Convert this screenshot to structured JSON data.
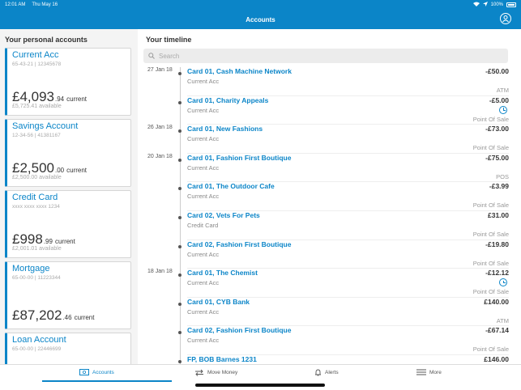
{
  "status": {
    "time": "12:01 AM",
    "date": "Thu May 16",
    "battery": "100%"
  },
  "nav": {
    "title": "Accounts"
  },
  "left": {
    "heading": "Your personal accounts",
    "accounts": [
      {
        "name": "Current Acc",
        "number": "65-43-21 | 12345678",
        "balance_main": "£4,093",
        "balance_pence": ".94",
        "balance_label": "current",
        "available": "£5,725.41 available"
      },
      {
        "name": "Savings Account",
        "number": "12-34-56 | 41381167",
        "balance_main": "£2,500",
        "balance_pence": ".00",
        "balance_label": "current",
        "available": "£2,500.00 available"
      },
      {
        "name": "Credit Card",
        "number": "xxxx xxxx xxxx 1234",
        "balance_main": "£998",
        "balance_pence": ".99",
        "balance_label": "current",
        "available": "£2,001.01 available"
      },
      {
        "name": "Mortgage",
        "number": "65-00-00 | 11223344",
        "balance_main": "£87,202",
        "balance_pence": ".46",
        "balance_label": "current",
        "available": ""
      },
      {
        "name": "Loan Account",
        "number": "65-00-00 | 22446699",
        "balance_main": "",
        "balance_pence": "",
        "balance_label": "",
        "available": ""
      }
    ]
  },
  "right": {
    "heading": "Your timeline",
    "search_placeholder": "Search",
    "transactions": [
      {
        "date": "27 Jan 18",
        "merchant": "Card 01, Cash Machine Network",
        "account": "Current Acc",
        "amount": "-£50.00",
        "type": "ATM",
        "pending": false
      },
      {
        "date": "",
        "merchant": "Card 01, Charity Appeals",
        "account": "Current Acc",
        "amount": "-£5.00",
        "type": "Point Of Sale",
        "pending": true
      },
      {
        "date": "26 Jan 18",
        "merchant": "Card 01, New Fashions",
        "account": "Current Acc",
        "amount": "-£73.00",
        "type": "Point Of Sale",
        "pending": false
      },
      {
        "date": "20 Jan 18",
        "merchant": "Card 01, Fashion First Boutique",
        "account": "Current Acc",
        "amount": "-£75.00",
        "type": "POS",
        "pending": false
      },
      {
        "date": "",
        "merchant": "Card 01, The Outdoor Cafe",
        "account": "Current Acc",
        "amount": "-£3.99",
        "type": "Point Of Sale",
        "pending": false
      },
      {
        "date": "",
        "merchant": "Card 02, Vets For Pets",
        "account": "Credit Card",
        "amount": "£31.00",
        "type": "Point Of Sale",
        "pending": false
      },
      {
        "date": "",
        "merchant": "Card 02, Fashion First Boutique",
        "account": "Current Acc",
        "amount": "-£19.80",
        "type": "Point Of Sale",
        "pending": false
      },
      {
        "date": "18 Jan 18",
        "merchant": "Card 01, The Chemist",
        "account": "Current Acc",
        "amount": "-£12.12",
        "type": "Point Of Sale",
        "pending": true
      },
      {
        "date": "",
        "merchant": "Card 01, CYB Bank",
        "account": "Current Acc",
        "amount": "£140.00",
        "type": "ATM",
        "pending": false
      },
      {
        "date": "",
        "merchant": "Card 02, Fashion First Boutique",
        "account": "Current Acc",
        "amount": "-£67.14",
        "type": "Point Of Sale",
        "pending": false
      },
      {
        "date": "",
        "merchant": "FP, BOB Barnes 1231",
        "account": "",
        "amount": "£146.00",
        "type": "",
        "pending": false
      }
    ]
  },
  "tabs": {
    "accounts": "Accounts",
    "move_money": "Move Money",
    "alerts": "Alerts",
    "more": "More"
  },
  "colors": {
    "brand": "#0b85c8"
  }
}
